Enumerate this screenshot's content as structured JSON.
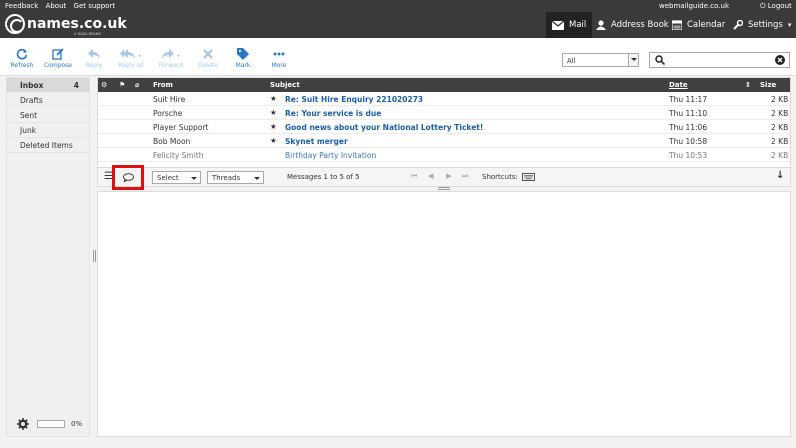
{
  "topbar": {
    "links": [
      "Feedback",
      "About",
      "Get support"
    ],
    "brand": "names.co.uk",
    "brand_sub": "A DADA BRAND",
    "user": "webmailguide.co.uk",
    "logout": "Logout",
    "nav": [
      {
        "label": "Mail",
        "icon": "envelope-icon",
        "active": true
      },
      {
        "label": "Address Book",
        "icon": "person-icon"
      },
      {
        "label": "Calendar",
        "icon": "calendar-icon"
      },
      {
        "label": "Settings",
        "icon": "wrench-icon"
      }
    ]
  },
  "toolbar": {
    "refresh": "Refresh",
    "compose": "Compose",
    "reply": "Reply",
    "reply_all": "Reply all",
    "forward": "Forward",
    "delete": "Delete",
    "mark": "Mark",
    "more": "More"
  },
  "filter": {
    "value": "All"
  },
  "folders": [
    {
      "name": "Inbox",
      "count": "4"
    },
    {
      "name": "Drafts"
    },
    {
      "name": "Sent"
    },
    {
      "name": "Junk"
    },
    {
      "name": "Deleted Items"
    }
  ],
  "quota": {
    "percent": "0%"
  },
  "list": {
    "columns": {
      "from": "From",
      "subject": "Subject",
      "date": "Date",
      "size": "Size"
    },
    "rows": [
      {
        "from": "Suit Hire",
        "subject": "Re: Suit Hire Enquiry 221020273",
        "date": "Thu 11:17",
        "size": "2 KB"
      },
      {
        "from": "Porsche",
        "subject": "Re: Your service is due",
        "date": "Thu 11:10",
        "size": "2 KB"
      },
      {
        "from": "Player Support",
        "subject": "Good news about your National Lottery Ticket!",
        "date": "Thu 11:06",
        "size": "2 KB"
      },
      {
        "from": "Bob Moon",
        "subject": "Skynet merger",
        "date": "Thu 10:58",
        "size": "2 KB"
      },
      {
        "from": "Felicity Smith",
        "subject": "Birthday Party Invitation",
        "date": "Thu 10:53",
        "size": "2 KB"
      }
    ]
  },
  "listfoot": {
    "select": "Select",
    "threads": "Threads",
    "count": "Messages 1 to 5 of 5",
    "shortcuts": "Shortcuts:"
  }
}
